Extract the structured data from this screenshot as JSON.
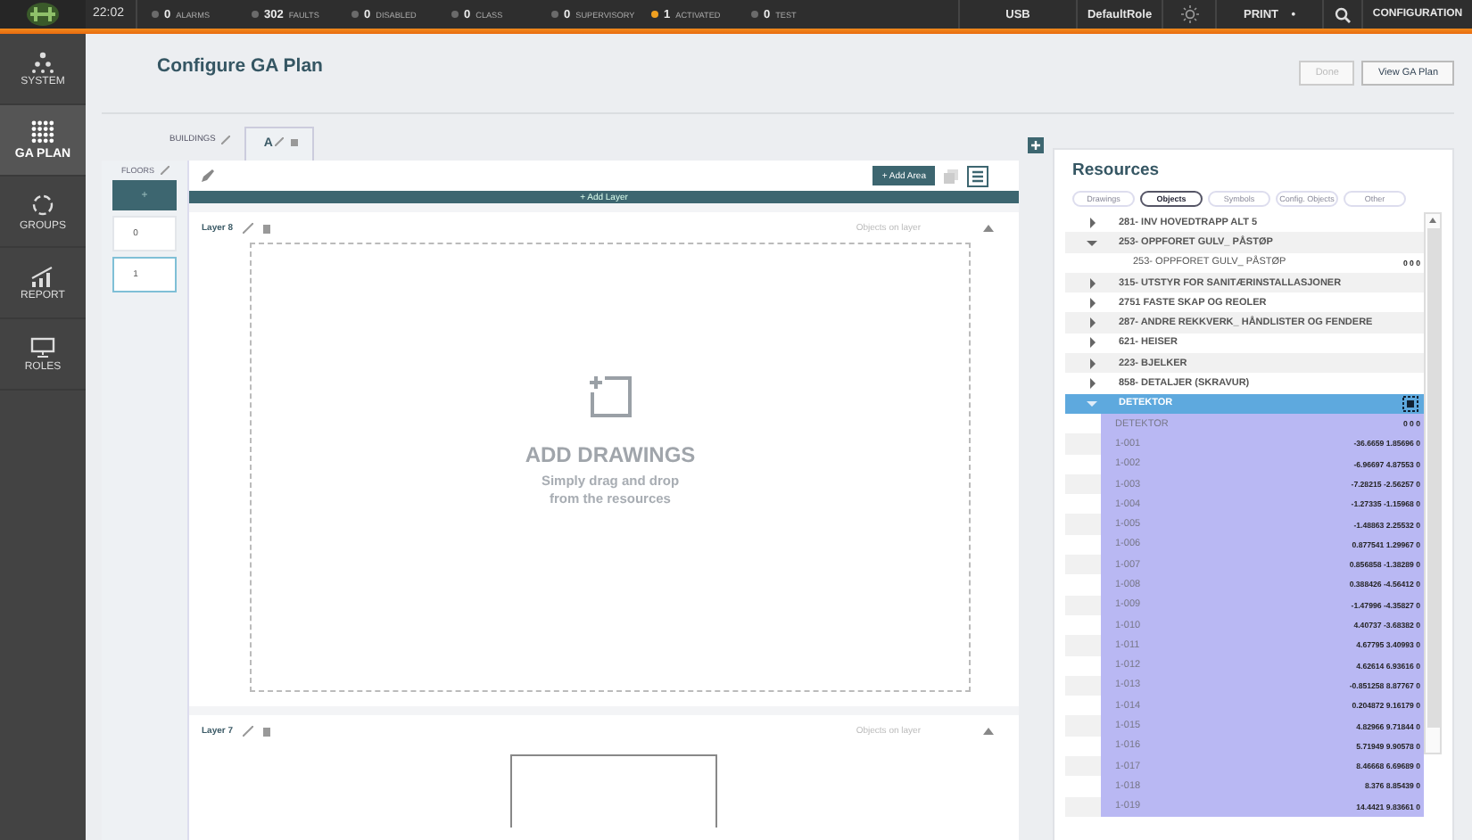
{
  "top_bar": {
    "time": "22:02",
    "statuses": [
      {
        "count": "0",
        "label": "ALARMS",
        "color": "#6b6b6b"
      },
      {
        "count": "302",
        "label": "FAULTS",
        "color": "#6b6b6b"
      },
      {
        "count": "0",
        "label": "DISABLED",
        "color": "#6b6b6b"
      },
      {
        "count": "0",
        "label": "CLASS",
        "color": "#6b6b6b"
      },
      {
        "count": "0",
        "label": "SUPERVISORY",
        "color": "#6b6b6b"
      },
      {
        "count": "1",
        "label": "ACTIVATED",
        "color": "#f0a020"
      },
      {
        "count": "0",
        "label": "TEST",
        "color": "#6b6b6b"
      }
    ],
    "usb": "USB",
    "role": "DefaultRole",
    "print": "PRINT",
    "print_dot": "•",
    "configuration": "CONFIGURATION"
  },
  "sidebar": {
    "items": [
      {
        "label": "SYSTEM",
        "selected": false
      },
      {
        "label": "GA PLAN",
        "selected": true
      },
      {
        "label": "GROUPS",
        "selected": false
      },
      {
        "label": "REPORT",
        "selected": false
      },
      {
        "label": "ROLES",
        "selected": false
      }
    ]
  },
  "header": {
    "title": "Configure GA Plan",
    "buttons": [
      {
        "label": "Done",
        "disabled": true
      },
      {
        "label": "View GA Plan",
        "disabled": false
      }
    ]
  },
  "buildings_tab": "BUILDINGS",
  "tabs": [
    {
      "label": "A",
      "selected": true
    }
  ],
  "floors": {
    "label": "FLOORS",
    "add": "+",
    "items": [
      {
        "label": "0",
        "selected": false
      },
      {
        "label": "1",
        "selected": true
      }
    ]
  },
  "workspace": {
    "add_area": "+ Add Area",
    "add_layer": "+ Add Layer",
    "layers": [
      {
        "name": "Layer 8",
        "objects_label": "Objects on layer",
        "kind": "empty",
        "title": "ADD DRAWINGS",
        "hint": "Simply drag and drop from the resources"
      },
      {
        "name": "Layer 7",
        "objects_label": "Objects on layer",
        "kind": "drawing"
      }
    ]
  },
  "resources": {
    "title": "Resources",
    "tabs": [
      {
        "label": "Drawings",
        "selected": false
      },
      {
        "label": "Objects",
        "selected": true
      },
      {
        "label": "Symbols",
        "selected": false
      },
      {
        "label": "Config. Objects",
        "selected": false
      },
      {
        "label": "Other",
        "selected": false
      }
    ],
    "tree": [
      {
        "label": "281- INV HOVEDTRAPP ALT 5",
        "expanded": false,
        "selected": false
      },
      {
        "label": "253- OPPFORET GULV_ PÅSTØP",
        "expanded": true,
        "selected": false,
        "children": [
          {
            "label": "253- OPPFORET GULV_ PÅSTØP",
            "value": "0 0 0"
          }
        ]
      },
      {
        "label": "315- UTSTYR FOR SANITÆRINSTALLASJONER",
        "expanded": false,
        "selected": false
      },
      {
        "label": "2751 FASTE SKAP OG REOLER",
        "expanded": false,
        "selected": false
      },
      {
        "label": "287- ANDRE REKKVERK_ HÅNDLISTER OG FENDERE",
        "expanded": false,
        "selected": false
      },
      {
        "label": "621- HEISER",
        "expanded": false,
        "selected": false
      },
      {
        "label": "223- BJELKER",
        "expanded": false,
        "selected": false
      },
      {
        "label": "858- DETALJER (SKRAVUR)",
        "expanded": false,
        "selected": false
      },
      {
        "label": "DETEKTOR",
        "expanded": true,
        "selected": true,
        "children": [
          {
            "label": "DETEKTOR",
            "value": "0 0 0"
          },
          {
            "label": "1-001",
            "value": "-36.6659 1.85696 0"
          },
          {
            "label": "1-002",
            "value": "-6.96697 4.87553 0"
          },
          {
            "label": "1-003",
            "value": "-7.28215 -2.56257 0"
          },
          {
            "label": "1-004",
            "value": "-1.27335 -1.15968 0"
          },
          {
            "label": "1-005",
            "value": "-1.48863 2.25532 0"
          },
          {
            "label": "1-006",
            "value": "0.877541 1.29967 0"
          },
          {
            "label": "1-007",
            "value": "0.856858 -1.38289 0"
          },
          {
            "label": "1-008",
            "value": "0.388426 -4.56412 0"
          },
          {
            "label": "1-009",
            "value": "-1.47996 -4.35827 0"
          },
          {
            "label": "1-010",
            "value": "4.40737 -3.68382 0"
          },
          {
            "label": "1-011",
            "value": "4.67795 3.40993 0"
          },
          {
            "label": "1-012",
            "value": "4.62614 6.93616 0"
          },
          {
            "label": "1-013",
            "value": "-0.851258 8.87767 0"
          },
          {
            "label": "1-014",
            "value": "0.204872 9.16179 0"
          },
          {
            "label": "1-015",
            "value": "4.82966 9.71844 0"
          },
          {
            "label": "1-016",
            "value": "5.71949 9.90578 0"
          },
          {
            "label": "1-017",
            "value": "8.46668 6.69689 0"
          },
          {
            "label": "1-018",
            "value": "8.376 8.85439 0"
          },
          {
            "label": "1-019",
            "value": "14.4421 9.83661 0"
          }
        ]
      }
    ]
  }
}
